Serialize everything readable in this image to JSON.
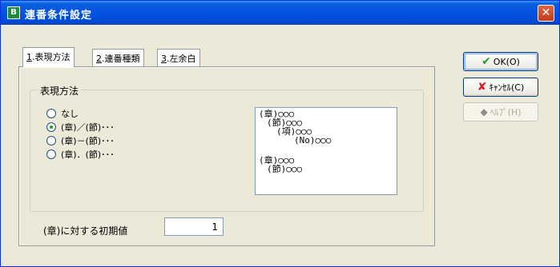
{
  "window": {
    "title": "連番条件設定",
    "close_glyph": "✕",
    "icon_glyph": "B"
  },
  "tabs": [
    {
      "key": "1",
      "label": ".表現方法",
      "active": true
    },
    {
      "key": "2",
      "label": ".連番種類",
      "active": false
    },
    {
      "key": "3",
      "label": ".左余白",
      "active": false
    }
  ],
  "group": {
    "label": "表現方法",
    "options": [
      {
        "label": "なし",
        "selected": false
      },
      {
        "label": "(章)／(節)･･･",
        "selected": true
      },
      {
        "label": "(章)－(節)･･･",
        "selected": false
      },
      {
        "label": "(章)．(節)･･･",
        "selected": false
      }
    ],
    "preview_lines": [
      "(章)○○○",
      "(節)○○○",
      "(項)○○○",
      "(No)○○○",
      "(章)○○○",
      "(節)○○○"
    ]
  },
  "initial": {
    "label": "(章)に対する初期値",
    "value": "1"
  },
  "buttons": {
    "ok": "OK(O)",
    "cancel": "ｷｬﾝｾﾙ(C)",
    "help": "ﾍﾙﾌﾟ(H)"
  },
  "icons": {
    "ok": "check-icon",
    "cancel": "cross-icon",
    "help": "help-book-icon",
    "close": "close-icon",
    "app": "app-icon"
  }
}
